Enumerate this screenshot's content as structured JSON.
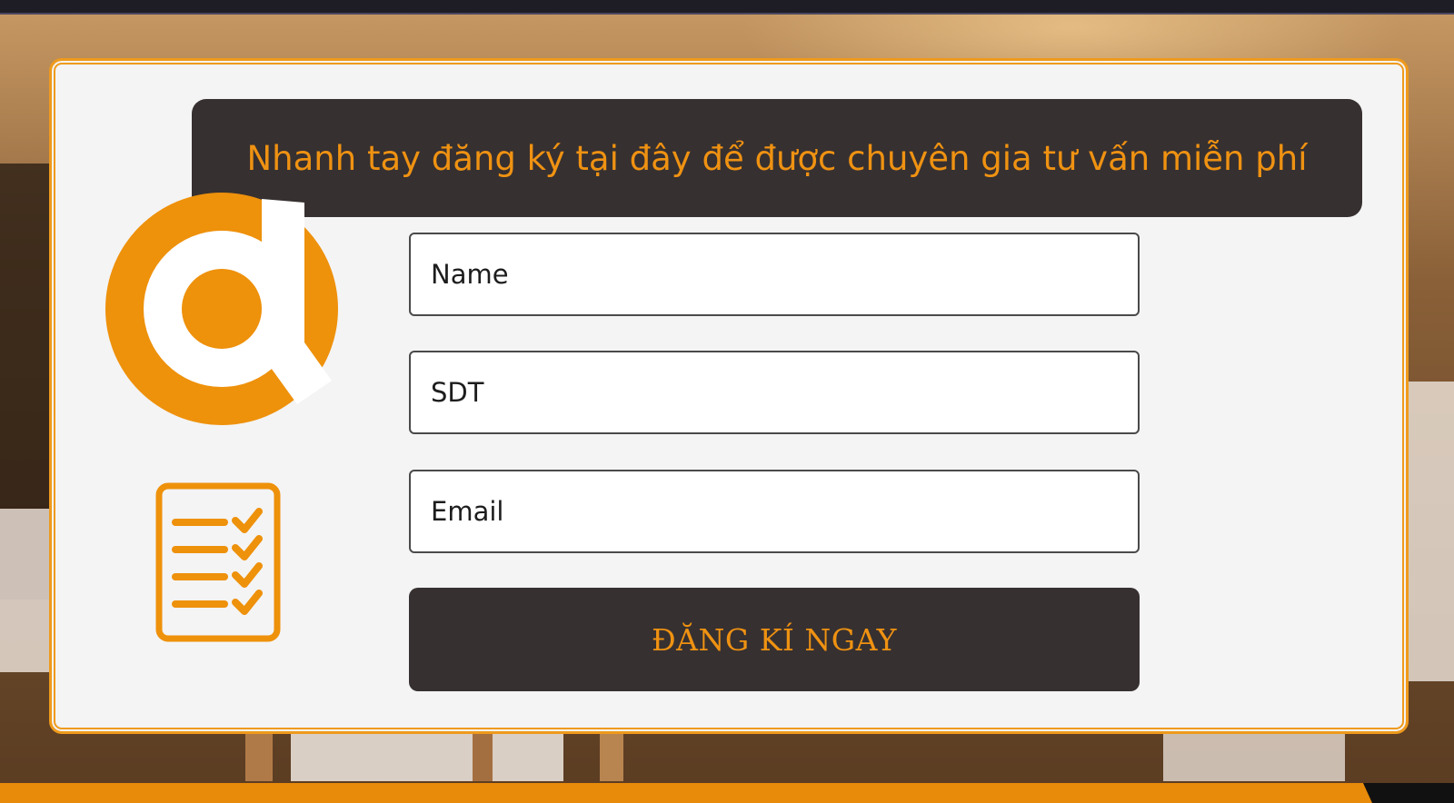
{
  "form": {
    "header_text": "Nhanh tay đăng ký tại đây để được chuyên gia tư vấn miễn phí",
    "name_placeholder": "Name",
    "phone_placeholder": "SDT",
    "email_placeholder": "Email",
    "submit_label": "ĐĂNG KÍ NGAY"
  },
  "icons": {
    "logo": "brand-logo-d",
    "checklist": "checklist-icon"
  },
  "colors": {
    "accent_orange": "#ef9212",
    "dark_panel": "#373030",
    "modal_bg": "#f4f4f4",
    "bottom_bar": "#e88a0a"
  }
}
